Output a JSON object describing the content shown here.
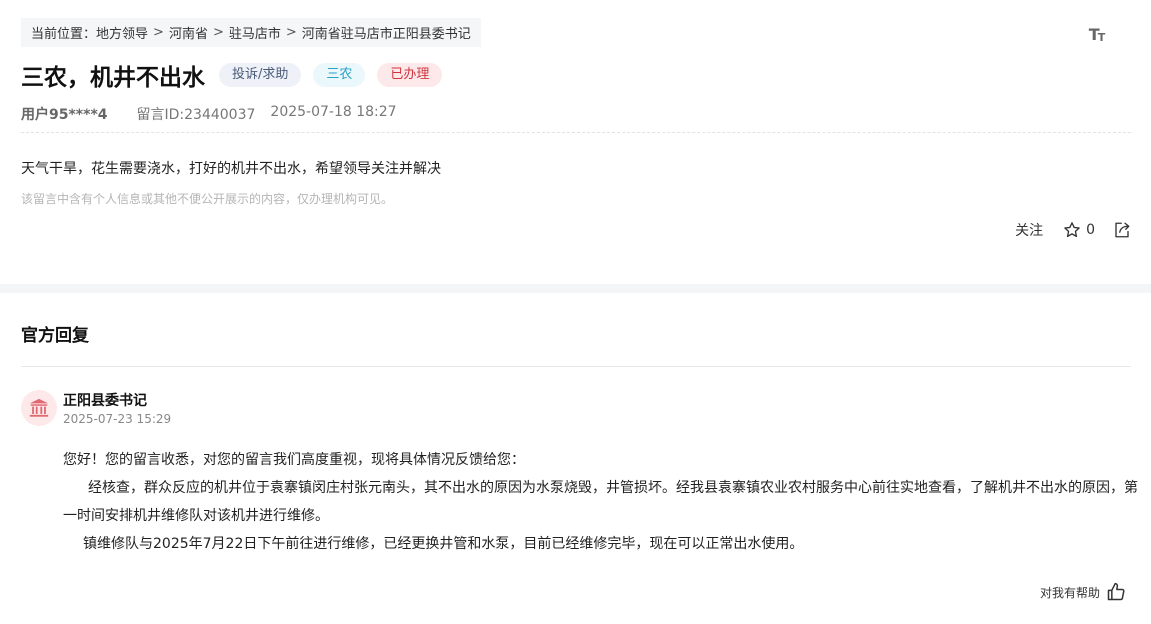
{
  "breadcrumb": {
    "prefix": "当前位置：",
    "items": [
      "地方领导",
      "河南省",
      "驻马店市",
      "河南省驻马店市正阳县委书记"
    ],
    "separator": ">"
  },
  "font_toggle": {
    "icon": "font-size-icon",
    "label_big": "T",
    "label_small": "T"
  },
  "post": {
    "title": "三农，机井不出水",
    "tags": {
      "type": "投诉/求助",
      "field": "三农",
      "status": "已办理"
    },
    "user": "用户95****4",
    "message_id": "留言ID:23440037",
    "datetime": "2025-07-18 18:27",
    "content": "天气干旱，花生需要浇水，打好的机井不出水，希望领导关注并解决",
    "privacy_note": "该留言中含有个人信息或其他不便公开展示的内容，仅办理机构可见。"
  },
  "actions": {
    "follow_label": "关注",
    "star_count": "0",
    "star_icon": "star-icon",
    "share_icon": "share-icon"
  },
  "reply_section": {
    "title": "官方回复",
    "responder": "正阳县委书记",
    "avatar_icon": "government-building-icon",
    "time": "2025-07-23 15:29",
    "paragraphs": [
      "您好！您的留言收悉，对您的留言我们高度重视，现将具体情况反馈给您：",
      "经核查，群众反应的机井位于袁寨镇闵庄村张元南头，其不出水的原因为水泵烧毁，井管损坏。经我县袁寨镇农业农村服务中心前往实地查看，了解机井不出水的原因，第一时间安排机井维修队对该机井进行维修。",
      "镇维修队与2025年7月22日下午前往进行维修，已经更换井管和水泵，目前已经维修完毕，现在可以正常出水使用。"
    ],
    "helpful_label": "对我有帮助",
    "helpful_icon": "thumbs-up-icon"
  },
  "colors": {
    "status_red": "#d0353f",
    "field_blue": "#2a9fc9",
    "avatar_bg": "#fde8ea",
    "avatar_icon": "#e06a72"
  }
}
